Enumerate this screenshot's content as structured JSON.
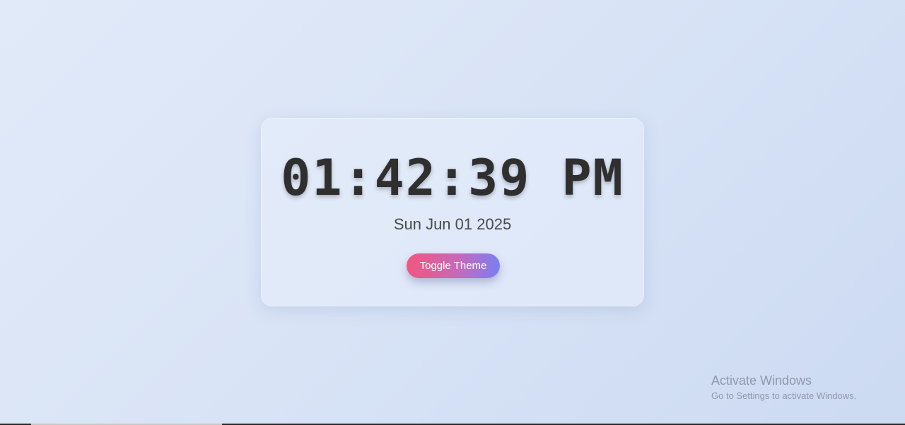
{
  "clock": {
    "time": "01:42:39 PM",
    "date": "Sun Jun 01 2025"
  },
  "controls": {
    "toggle_label": "Toggle Theme"
  },
  "watermark": {
    "title": "Activate Windows",
    "subtitle": "Go to Settings to activate Windows."
  },
  "colors": {
    "background": "#dbe5f7",
    "card": "#e2eaf8",
    "clock_text": "#2f2f2f",
    "date_text": "#4a4a4a",
    "button_gradient_start": "#f0577e",
    "button_gradient_end": "#7a7ff4"
  }
}
